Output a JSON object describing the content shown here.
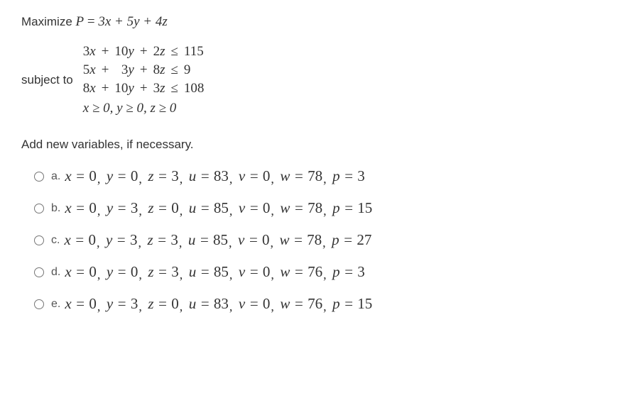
{
  "maximize": {
    "label": "Maximize",
    "lhs": "P",
    "rhs": "3x + 5y + 4z"
  },
  "subjectTo": {
    "label": "subject to",
    "rows": [
      {
        "c1": "3",
        "v1": "x",
        "op1": "+",
        "c2": "10",
        "v2": "y",
        "op2": "+",
        "c3": "2",
        "v3": "z",
        "rel": "≤",
        "rhs": "115"
      },
      {
        "c1": "5",
        "v1": "x",
        "op1": "+",
        "c2": "3",
        "v2": "y",
        "op2": "+",
        "c3": "8",
        "v3": "z",
        "rel": "≤",
        "rhs": "9"
      },
      {
        "c1": "8",
        "v1": "x",
        "op1": "+",
        "c2": "10",
        "v2": "y",
        "op2": "+",
        "c3": "3",
        "v3": "z",
        "rel": "≤",
        "rhs": "108"
      }
    ],
    "nonneg": "x ≥ 0, y ≥ 0, z ≥ 0"
  },
  "instruction": "Add new variables, if necessary.",
  "options": [
    {
      "letter": "a.",
      "x": "0",
      "y": "0",
      "z": "3",
      "u": "83",
      "v": "0",
      "w": "78",
      "p": "3"
    },
    {
      "letter": "b.",
      "x": "0",
      "y": "3",
      "z": "0",
      "u": "85",
      "v": "0",
      "w": "78",
      "p": "15"
    },
    {
      "letter": "c.",
      "x": "0",
      "y": "3",
      "z": "3",
      "u": "85",
      "v": "0",
      "w": "78",
      "p": "27"
    },
    {
      "letter": "d.",
      "x": "0",
      "y": "0",
      "z": "3",
      "u": "85",
      "v": "0",
      "w": "76",
      "p": "3"
    },
    {
      "letter": "e.",
      "x": "0",
      "y": "3",
      "z": "0",
      "u": "83",
      "v": "0",
      "w": "76",
      "p": "15"
    }
  ]
}
